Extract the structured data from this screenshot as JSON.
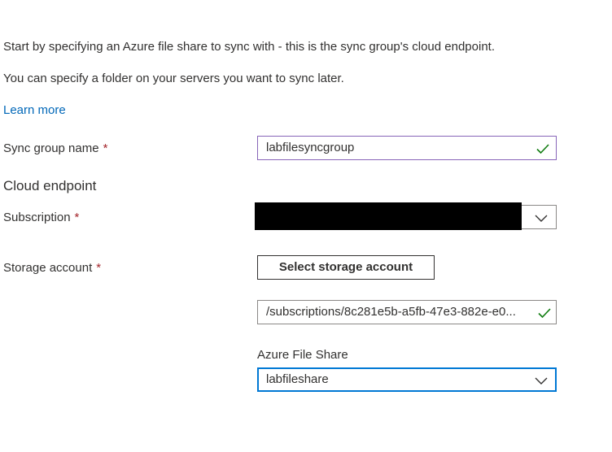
{
  "intro": {
    "line1": "Start by specifying an Azure file share to sync with - this is the sync group's cloud endpoint.",
    "line2": "You can specify a folder on your servers you want to sync later.",
    "learn_more": "Learn more"
  },
  "form": {
    "required_marker": "*",
    "sync_group": {
      "label": "Sync group name",
      "value": "labfilesyncgroup"
    },
    "cloud_endpoint_heading": "Cloud endpoint",
    "subscription": {
      "label": "Subscription",
      "value": ""
    },
    "storage_account": {
      "label": "Storage account",
      "button_label": "Select storage account",
      "value": "/subscriptions/8c281e5b-a5fb-47e3-882e-e0..."
    },
    "file_share": {
      "label": "Azure File Share",
      "value": "labfileshare"
    }
  },
  "colors": {
    "link": "#0067b8",
    "required": "#a4262c",
    "valid_check": "#107c10",
    "focus_border": "#0078d4",
    "active_border": "#8764b8"
  }
}
